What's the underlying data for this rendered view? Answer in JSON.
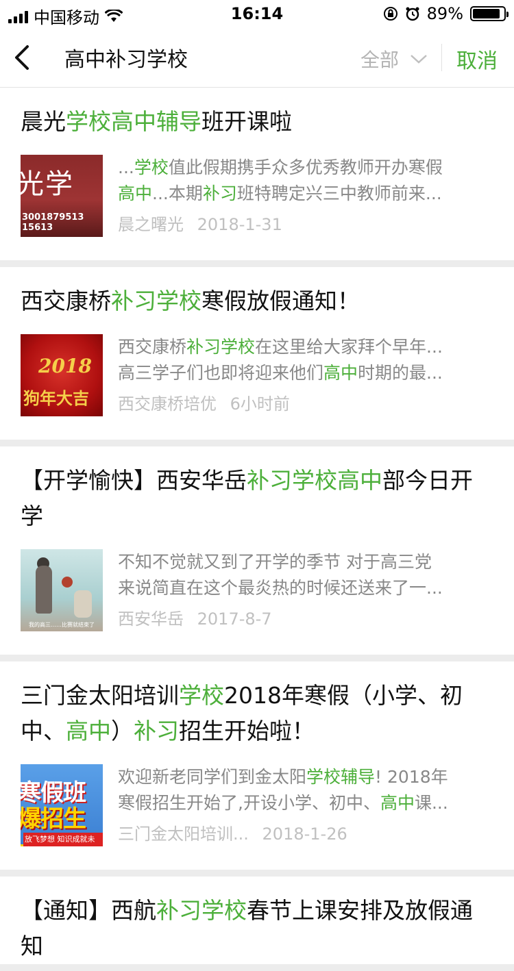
{
  "status_bar": {
    "carrier": "中国移动",
    "time": "16:14",
    "battery_text": "89%",
    "battery_level": 0.89
  },
  "nav": {
    "query": "高中补习学校",
    "filter_label": "全部",
    "cancel_label": "取消"
  },
  "colors": {
    "highlight": "#4caf3a",
    "meta": "#c0c0c0",
    "snippet": "#888888"
  },
  "results": [
    {
      "title": [
        {
          "t": "晨光"
        },
        {
          "t": "学校",
          "h": true
        },
        {
          "t": "高中",
          "h": true
        },
        {
          "t": "辅导",
          "h": true
        },
        {
          "t": "班开课啦"
        }
      ],
      "snippet_lines": [
        [
          {
            "t": "..."
          },
          {
            "t": "学校",
            "h": true
          },
          {
            "t": "值此假期携手众多优秀教师开办寒假"
          }
        ],
        [
          {
            "t": "高中",
            "h": true
          },
          {
            "t": "...本期"
          },
          {
            "t": "补习",
            "h": true
          },
          {
            "t": "班特聘定兴三中教师前来..."
          }
        ]
      ],
      "source": "晨之曙光",
      "date": "2018-1-31",
      "thumb_text": "光学",
      "thumb_sub": "3001879513   15613"
    },
    {
      "title": [
        {
          "t": "西交康桥"
        },
        {
          "t": "补习",
          "h": true
        },
        {
          "t": "学校",
          "h": true
        },
        {
          "t": "寒假放假通知！"
        }
      ],
      "snippet_lines": [
        [
          {
            "t": "西交康桥"
          },
          {
            "t": "补习",
            "h": true
          },
          {
            "t": "学校",
            "h": true
          },
          {
            "t": "在这里给大家拜个早年..."
          }
        ],
        [
          {
            "t": "高三学子们也即将迎来他们"
          },
          {
            "t": "高中",
            "h": true
          },
          {
            "t": "时期的最..."
          }
        ]
      ],
      "source": "西交康桥培优",
      "date": "6小时前",
      "thumb_text": "2018",
      "thumb_sub": "狗年大吉"
    },
    {
      "title": [
        {
          "t": "【开学愉快】西安华岳"
        },
        {
          "t": "补习",
          "h": true
        },
        {
          "t": "学校",
          "h": true
        },
        {
          "t": "高中",
          "h": true
        },
        {
          "t": "部今日开学"
        }
      ],
      "snippet_lines": [
        [
          {
            "t": "不知不觉就又到了开学的季节 对于高三党"
          }
        ],
        [
          {
            "t": "来说简直在这个最炎热的时候还送来了一..."
          }
        ]
      ],
      "source": "西安华岳",
      "date": "2017-8-7",
      "thumb_text": "",
      "thumb_sub": "我的高三……比赛就结束了"
    },
    {
      "title": [
        {
          "t": "三门金太阳培训"
        },
        {
          "t": "学校",
          "h": true
        },
        {
          "t": "2018年寒假（小学、初中、"
        },
        {
          "t": "高中",
          "h": true
        },
        {
          "t": "）"
        },
        {
          "t": "补习",
          "h": true
        },
        {
          "t": "招生开始啦！"
        }
      ],
      "snippet_lines": [
        [
          {
            "t": "欢迎新老同学们到金太阳"
          },
          {
            "t": "学校",
            "h": true
          },
          {
            "t": "辅导",
            "h": true
          },
          {
            "t": "! 2018年"
          }
        ],
        [
          {
            "t": "寒假招生开始了,开设小学、初中、"
          },
          {
            "t": "高中",
            "h": true
          },
          {
            "t": "课..."
          }
        ]
      ],
      "source": "三门金太阳培训...",
      "date": "2018-1-26",
      "thumb_text": "寒假班",
      "thumb_sub": "爆招生中",
      "thumb_tag": "放飞梦想 知识成就未来"
    },
    {
      "title": [
        {
          "t": "【通知】西航"
        },
        {
          "t": "补习",
          "h": true
        },
        {
          "t": "学校",
          "h": true
        },
        {
          "t": "春节上课安排及放假通知"
        }
      ],
      "snippet_lines": [],
      "source": "",
      "date": "",
      "thumb_text": "",
      "thumb_sub": ""
    }
  ]
}
